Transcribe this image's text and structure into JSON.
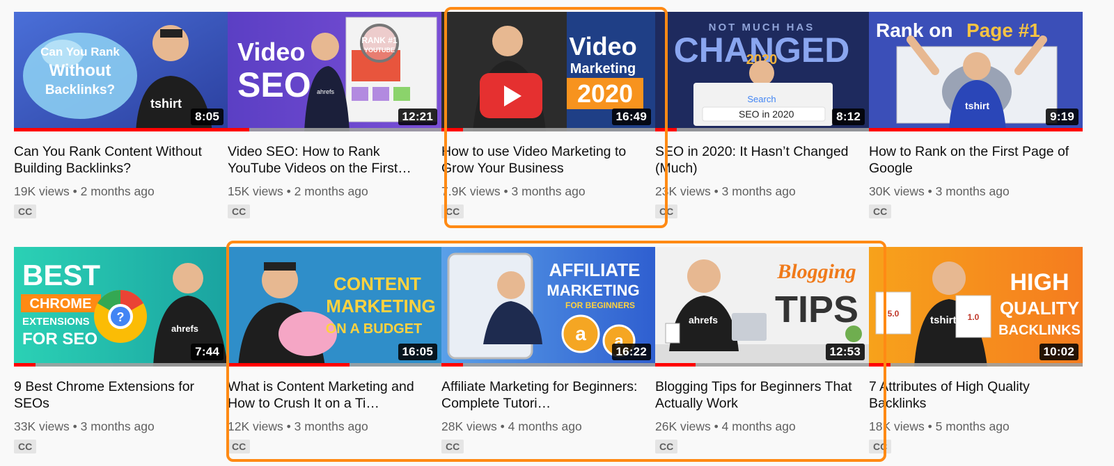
{
  "videos": [
    {
      "title": "Can You Rank Content Without Building Backlinks?",
      "views": "19K views",
      "age": "2 months ago",
      "duration": "8:05",
      "progress": 1.0,
      "cc": "CC",
      "thumb_text": [
        "Can You Rank",
        "Without",
        "Backlinks?"
      ],
      "shirt_text": "tshirt"
    },
    {
      "title": "Video SEO: How to Rank YouTube Videos on the First…",
      "views": "15K views",
      "age": "2 months ago",
      "duration": "12:21",
      "progress": 0.1,
      "cc": "CC",
      "thumb_text": [
        "Video",
        "SEO",
        "RANK #1",
        "YOUTUBE"
      ],
      "brand": "ahrefs"
    },
    {
      "title": "How to use Video Marketing to Grow Your Business",
      "views": "7.9K views",
      "age": "3 months ago",
      "duration": "16:49",
      "progress": 0.1,
      "cc": "CC",
      "thumb_text": [
        "Video",
        "Marketing",
        "2020"
      ]
    },
    {
      "title": "SEO in 2020: It Hasn’t Changed (Much)",
      "views": "23K views",
      "age": "3 months ago",
      "duration": "8:12",
      "progress": 0.1,
      "cc": "CC",
      "thumb_text": [
        "NOT MUCH HAS",
        "CHANGED",
        "2020",
        "Search",
        "SEO in 2020"
      ]
    },
    {
      "title": "How to Rank on the First Page of Google",
      "views": "30K views",
      "age": "3 months ago",
      "duration": "9:19",
      "progress": 1.0,
      "cc": "CC",
      "thumb_text": [
        "Rank on",
        "Page #1"
      ],
      "shirt_text": "tshirt"
    },
    {
      "title": "9 Best Chrome Extensions for SEOs",
      "views": "33K views",
      "age": "3 months ago",
      "duration": "7:44",
      "progress": 0.1,
      "cc": "CC",
      "thumb_text": [
        "BEST",
        "CHROME",
        "EXTENSIONS",
        "FOR SEO"
      ],
      "brand": "ahrefs"
    },
    {
      "title": "What is Content Marketing and How to Crush It on a Ti…",
      "views": "12K views",
      "age": "3 months ago",
      "duration": "16:05",
      "progress": 0.57,
      "cc": "CC",
      "thumb_text": [
        "CONTENT",
        "MARKETING",
        "ON A BUDGET"
      ]
    },
    {
      "title": "Affiliate Marketing for Beginners: Complete Tutori…",
      "views": "28K views",
      "age": "4 months ago",
      "duration": "16:22",
      "progress": 0.1,
      "cc": "CC",
      "thumb_text": [
        "AFFILIATE",
        "MARKETING",
        "FOR BEGINNERS"
      ]
    },
    {
      "title": "Blogging Tips for Beginners That Actually Work",
      "views": "26K views",
      "age": "4 months ago",
      "duration": "12:53",
      "progress": 0.19,
      "cc": "CC",
      "thumb_text": [
        "Blogging",
        "TIPS"
      ],
      "brand": "ahrefs"
    },
    {
      "title": "7 Attributes of High Quality Backlinks",
      "views": "18K views",
      "age": "5 months ago",
      "duration": "10:02",
      "progress": 0.1,
      "cc": "CC",
      "thumb_text": [
        "HIGH",
        "QUALITY",
        "BACKLINKS",
        "5.0",
        "1.0"
      ],
      "shirt_text": "tshirt"
    }
  ],
  "meta_separator": "•",
  "colors": {
    "highlight": "#ff8a14",
    "progress": "#ff0000"
  }
}
